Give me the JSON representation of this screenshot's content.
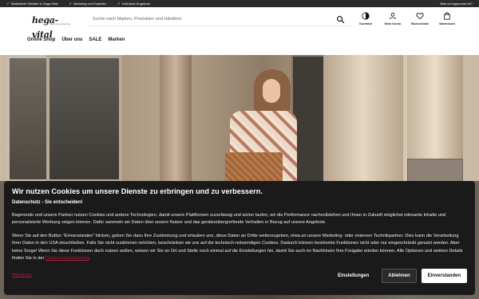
{
  "topbar": {
    "usps": [
      "Stationärer Händler in Hoga-Vital",
      "Beratung von Experten",
      "Exklusive Angebote"
    ],
    "right_link": "Was ist bagmondo.de?"
  },
  "header": {
    "logo_text": "hega-vital",
    "logo_tagline": "bags & accessories",
    "search_placeholder": "Suche nach Marken, Produkten und Händlern",
    "icons": [
      {
        "label": "Kontrast",
        "icon": "contrast-icon"
      },
      {
        "label": "Mein Konto",
        "icon": "user-icon"
      },
      {
        "label": "Wunschliste",
        "icon": "heart-icon"
      },
      {
        "label": "Warenkorb",
        "icon": "bag-icon"
      }
    ]
  },
  "nav": {
    "items": [
      "Online Shop",
      "Über uns",
      "SALE",
      "Marken"
    ]
  },
  "cookie": {
    "title": "Wir nutzen Cookies um unsere Dienste zu erbringen und zu verbessern.",
    "subtitle": "Datenschutz - Sie entscheiden!",
    "para1": "Bagmondo und unsere Partner nutzen Cookies und andere Technologien, damit unsere Plattformen zuverlässig und sicher laufen, wir die Performance nachvollziehen und Ihnen in Zukunft möglichst relevante Inhalte und personalisierte Werbung zeigen können. Dafür sammeln wir Daten über unsere Nutzer und das gerätesübergreifende Verhalten in Bezug auf unsere Angebote.",
    "para2_a": "Wenn Sie auf den Button ",
    "para2_em": "\"Einverstanden\"",
    "para2_b": " klicken, geben Sie dazu Ihre Zustimmung und erlauben uns, diese Daten an Dritte weiterzugeben, etwa an unsere Marketing- oder externen Technikpartner. Dies kann die Verarbeitung Ihrer Daten in den USA einschließen. Falls Sie nicht zustimmen möchten, beschränken wir uns auf die technisch-notwendigen Cookies. Dadurch können bestimmte Funktionen nicht oder nur eingeschränkt genutzt werden. Aber keine Sorge! Wenn Sie diese Funktionen doch nutzen wollen, weisen wir Sie an Ort und Stelle noch einmal auf die Einstellungen hin, damit Sie auch im Nachhinein Ihre Freigabe erteilen können. Alle Optionen und weitere Details finden Sie in der ",
    "para2_link": "Datenschutzerklärung",
    "para2_end": ".",
    "impressum": "Impressum",
    "btn_settings": "Einstellungen",
    "btn_reject": "Ablehnen",
    "btn_accept": "Einverstanden"
  }
}
